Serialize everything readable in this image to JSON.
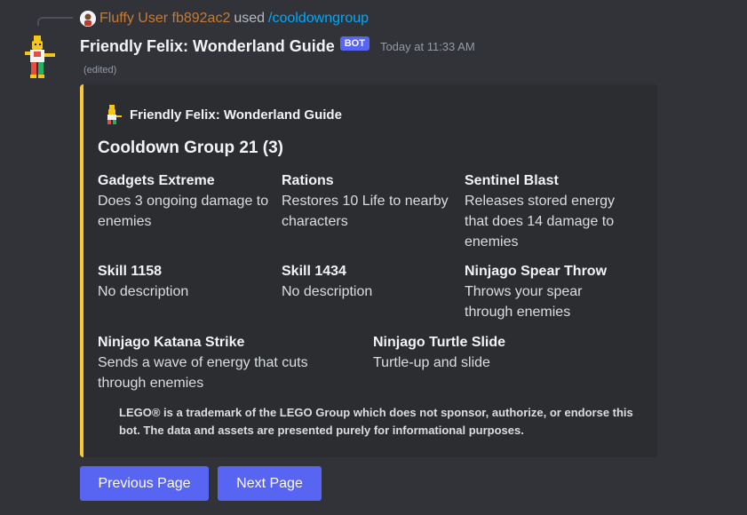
{
  "reply": {
    "user": "Fluffy User fb892ac2",
    "used": "used",
    "command": "/cooldowngroup"
  },
  "message": {
    "bot_name": "Friendly Felix: Wonderland Guide",
    "bot_tag": "BOT",
    "timestamp": "Today at 11:33 AM",
    "edited": "(edited)"
  },
  "embed": {
    "accent_color": "#fcc832",
    "author": "Friendly Felix: Wonderland Guide",
    "title": "Cooldown Group 21 (3)",
    "fields": [
      {
        "name": "Gadgets Extreme",
        "value": "Does 3 ongoing damage to enemies"
      },
      {
        "name": "Rations",
        "value": "Restores 10 Life to nearby characters"
      },
      {
        "name": "Sentinel Blast",
        "value": "Releases stored energy that does 14 damage to enemies"
      },
      {
        "name": "Skill 1158",
        "value": "No description"
      },
      {
        "name": "Skill 1434",
        "value": "No description"
      },
      {
        "name": "Ninjago Spear Throw",
        "value": "Throws your spear through enemies"
      },
      {
        "name": "Ninjago Katana Strike",
        "value": "Sends a wave of energy that cuts through enemies"
      },
      {
        "name": "Ninjago Turtle Slide",
        "value": "Turtle-up and slide"
      }
    ],
    "footer": "LEGO® is a trademark of the LEGO Group which does not sponsor, authorize, or endorse this bot. The data and assets are presented purely for informational purposes."
  },
  "buttons": {
    "previous": "Previous Page",
    "next": "Next Page"
  }
}
